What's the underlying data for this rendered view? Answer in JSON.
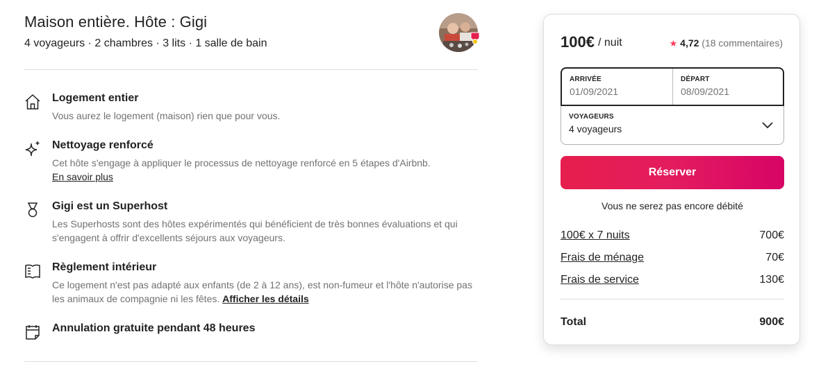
{
  "listing": {
    "title": "Maison entière. Hôte : Gigi",
    "subtitle": "4 voyageurs · 2 chambres · 3 lits · 1 salle de bain"
  },
  "features": [
    {
      "icon": "home-icon",
      "title": "Logement entier",
      "desc": "Vous aurez le logement (maison) rien que pour vous."
    },
    {
      "icon": "sparkle-icon",
      "title": "Nettoyage renforcé",
      "desc": "Cet hôte s'engage à appliquer le processus de nettoyage renforcé en 5 étapes d'Airbnb.",
      "link": "En savoir plus"
    },
    {
      "icon": "medal-icon",
      "title": "Gigi est un Superhost",
      "desc": "Les Superhosts sont des hôtes expérimentés qui bénéficient de très bonnes évaluations et qui s'engagent à offrir d'excellents séjours aux voyageurs."
    },
    {
      "icon": "book-icon",
      "title": "Règlement intérieur",
      "desc": "Ce logement n'est pas adapté aux enfants (de 2 à 12 ans), est non-fumeur et l'hôte n'autorise pas les animaux de compagnie ni les fêtes.",
      "link": "Afficher les détails"
    },
    {
      "icon": "calendar-icon",
      "title": "Annulation gratuite pendant 48 heures"
    }
  ],
  "booking": {
    "price": "100€",
    "per_night": "/ nuit",
    "rating_star": "★",
    "rating_value": "4,72",
    "rating_count": "(18 commentaires)",
    "checkin_label": "ARRIVÉE",
    "checkin_value": "01/09/2021",
    "checkout_label": "DÉPART",
    "checkout_value": "08/09/2021",
    "guests_label": "VOYAGEURS",
    "guests_value": "4 voyageurs",
    "reserve_label": "Réserver",
    "note": "Vous ne serez pas encore débité",
    "items": [
      {
        "label": "100€ x 7 nuits",
        "amount": "700€"
      },
      {
        "label": "Frais de ménage",
        "amount": "70€"
      },
      {
        "label": "Frais de service",
        "amount": "130€"
      }
    ],
    "total_label": "Total",
    "total_amount": "900€",
    "accent_color": "#FF385C"
  }
}
